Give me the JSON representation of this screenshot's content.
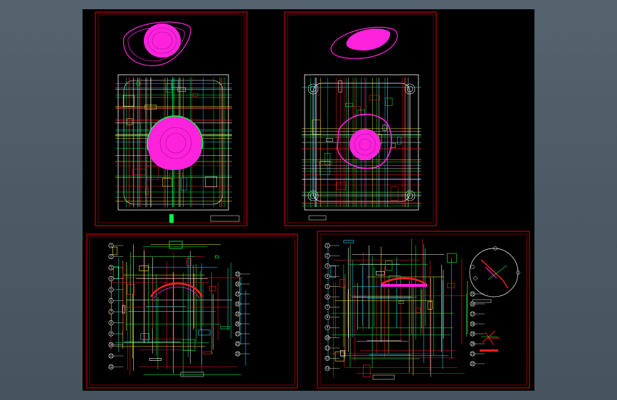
{
  "viewport": {
    "background": "#000000"
  },
  "colors": {
    "frame": "#c00000",
    "line_green": "#00ff44",
    "line_yellow": "#ffee33",
    "line_white": "#ffffff",
    "line_red": "#ff2020",
    "line_cyan": "#22e0ff",
    "accent_magenta": "#ff22dd",
    "line_blue": "#3a5cff"
  },
  "sheets": [
    {
      "id": "top-left",
      "kind": "plan",
      "label": "sheet-top-left"
    },
    {
      "id": "top-right",
      "kind": "plan",
      "label": "sheet-top-right"
    },
    {
      "id": "bottom-left",
      "kind": "section",
      "label": "sheet-bottom-left"
    },
    {
      "id": "bottom-right",
      "kind": "section",
      "label": "sheet-bottom-right"
    }
  ],
  "balloons_left": [
    "1",
    "2",
    "3",
    "4",
    "5",
    "6",
    "7",
    "8",
    "9",
    "10",
    "11",
    "12",
    "13",
    "14"
  ],
  "balloons_right": [
    "15",
    "16",
    "17",
    "18",
    "19",
    "20",
    "21",
    "22",
    "23",
    "24",
    "25",
    "26"
  ]
}
